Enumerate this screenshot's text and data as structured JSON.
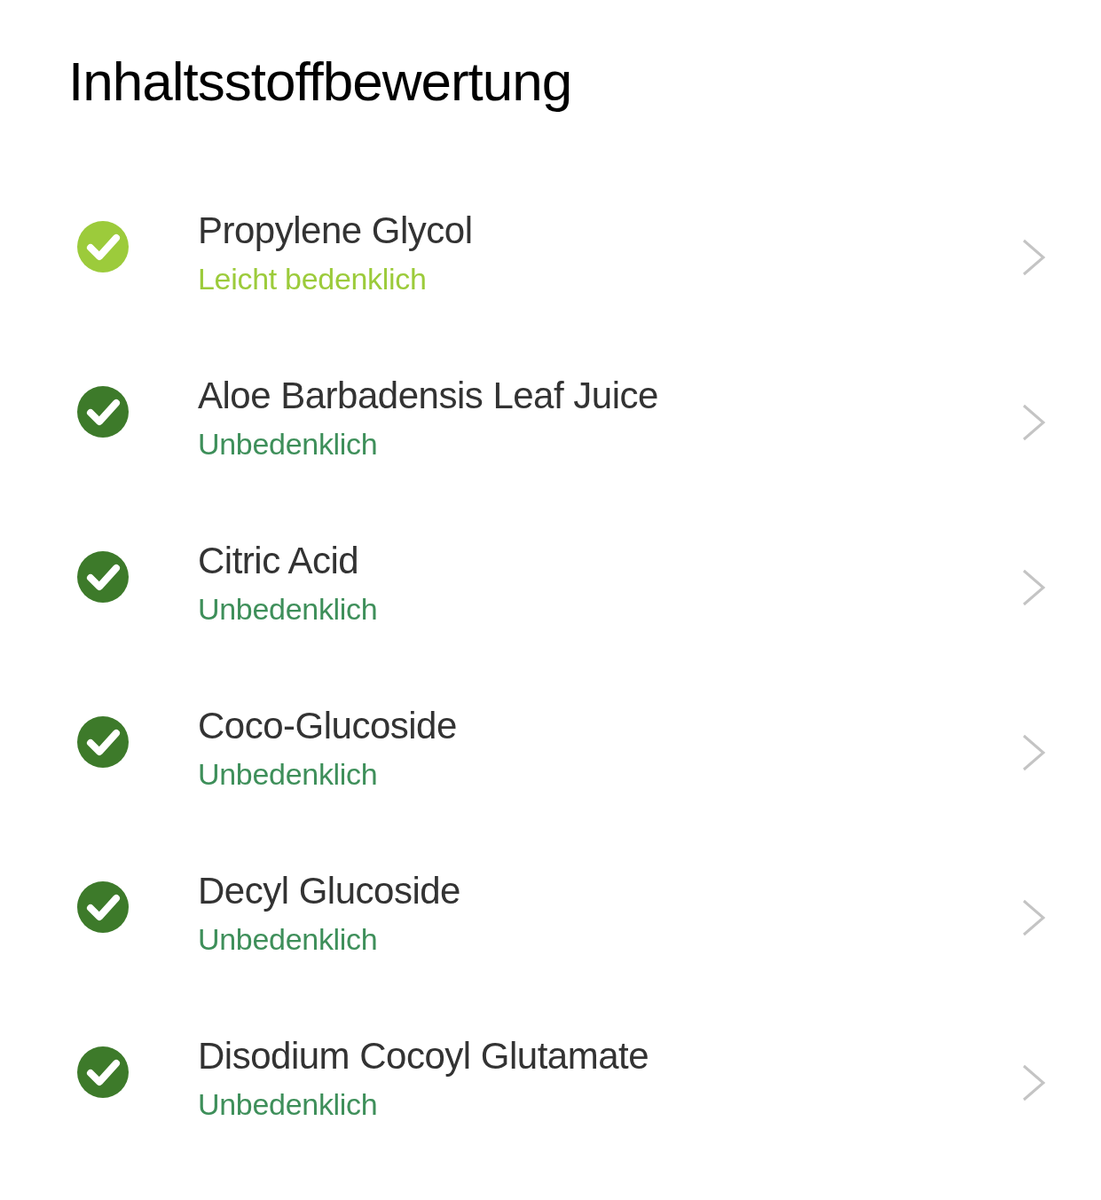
{
  "title": "Inhaltsstoffbewertung",
  "ingredients": [
    {
      "name": "Propylene Glycol",
      "rating": "Leicht bedenklich",
      "kind": "mild"
    },
    {
      "name": "Aloe Barbadensis Leaf Juice",
      "rating": "Unbedenklich",
      "kind": "safe"
    },
    {
      "name": "Citric Acid",
      "rating": "Unbedenklich",
      "kind": "safe"
    },
    {
      "name": "Coco-Glucoside",
      "rating": "Unbedenklich",
      "kind": "safe"
    },
    {
      "name": "Decyl Glucoside",
      "rating": "Unbedenklich",
      "kind": "safe"
    },
    {
      "name": "Disodium Cocoyl Glutamate",
      "rating": "Unbedenklich",
      "kind": "safe"
    }
  ]
}
